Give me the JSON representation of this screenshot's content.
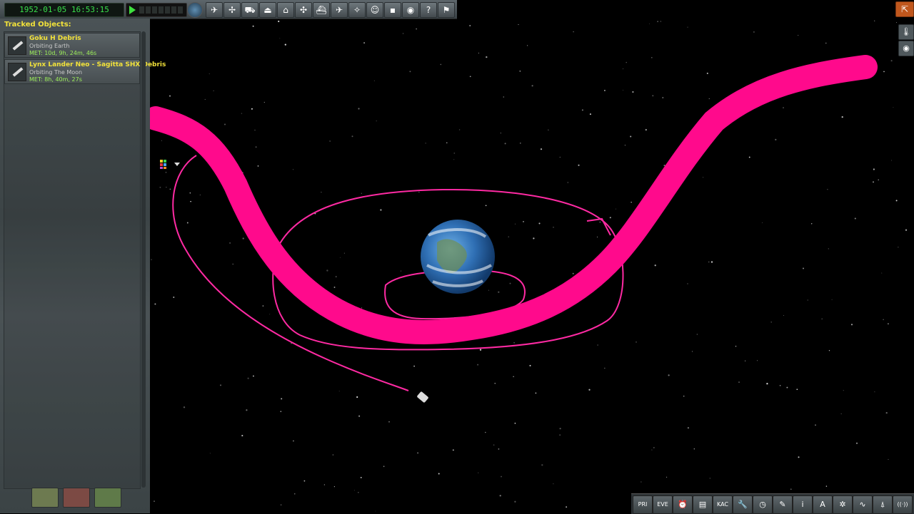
{
  "topbar": {
    "clock": "1952-01-05 16:53:15",
    "buttons": [
      {
        "name": "rocket-filter-button",
        "icon": "rocket-icon",
        "glyph": "✈"
      },
      {
        "name": "probe-filter-button",
        "icon": "probe-icon",
        "glyph": "✢"
      },
      {
        "name": "rover-filter-button",
        "icon": "rover-icon",
        "glyph": "⛟"
      },
      {
        "name": "lander-filter-button",
        "icon": "lander-icon",
        "glyph": "⏏"
      },
      {
        "name": "base-filter-button",
        "icon": "base-icon",
        "glyph": "⌂"
      },
      {
        "name": "station-filter-button",
        "icon": "station-icon",
        "glyph": "✣"
      },
      {
        "name": "ship-filter-button",
        "icon": "ship-icon",
        "glyph": "⛴"
      },
      {
        "name": "plane-filter-button",
        "icon": "plane-icon",
        "glyph": "✈"
      },
      {
        "name": "relay-filter-button",
        "icon": "relay-icon",
        "glyph": "✧"
      },
      {
        "name": "kerbal-filter-button",
        "icon": "kerbal-icon",
        "glyph": "☺"
      },
      {
        "name": "debris-filter-button",
        "icon": "debris-icon",
        "glyph": "▪"
      },
      {
        "name": "body-filter-button",
        "icon": "planet-icon",
        "glyph": "◉"
      },
      {
        "name": "help-button",
        "icon": "help-icon",
        "glyph": "?"
      },
      {
        "name": "launchpad-button",
        "icon": "launchpad-icon",
        "glyph": "⚑"
      }
    ]
  },
  "tracking": {
    "title": "Tracked Objects:",
    "items": [
      {
        "name": "Goku H Debris",
        "status": "Orbiting Earth",
        "met": "MET: 10d, 9h, 24m, 46s"
      },
      {
        "name": "Lynx Lander Neo - Sagitta SHX Debris",
        "status": "Orbiting The Moon",
        "met": "MET: 8h, 40m, 27s"
      }
    ],
    "bottom_buttons": [
      "fly-button",
      "delete-button",
      "recover-button"
    ]
  },
  "colors": {
    "orbit_line": "#ff2aa3",
    "annotation_stroke": "#ff0a8c",
    "clock_text": "#39e04b",
    "tracked_name": "#f2e23a",
    "met_text": "#9ef15a",
    "exit_button": "#c0571d"
  },
  "bottom_right": {
    "buttons": [
      {
        "name": "principia-button",
        "icon": "principia-icon",
        "glyph": "PRI"
      },
      {
        "name": "eve-button",
        "icon": "eve-icon",
        "glyph": "EVE"
      },
      {
        "name": "alarm-clock-button",
        "icon": "alarm-clock-icon",
        "glyph": "⏰"
      },
      {
        "name": "chart-button",
        "icon": "chart-icon",
        "glyph": "▤"
      },
      {
        "name": "kerbal-alarm-button",
        "icon": "kac-icon",
        "glyph": "KAC"
      },
      {
        "name": "wrench-button",
        "icon": "wrench-icon",
        "glyph": "🔧"
      },
      {
        "name": "clock-button",
        "icon": "clock-icon",
        "glyph": "◷"
      },
      {
        "name": "pencil-button",
        "icon": "pencil-icon",
        "glyph": "✎"
      },
      {
        "name": "info-button",
        "icon": "info-icon",
        "glyph": "i"
      },
      {
        "name": "autopilot-button",
        "icon": "autopilot-icon",
        "glyph": "A"
      },
      {
        "name": "settings-button",
        "icon": "settings-icon",
        "glyph": "✲"
      },
      {
        "name": "signal-button",
        "icon": "signal-icon",
        "glyph": "∿"
      },
      {
        "name": "antenna-button",
        "icon": "antenna-icon",
        "glyph": "⍋"
      },
      {
        "name": "comms-button",
        "icon": "comms-icon",
        "glyph": "((·))"
      }
    ]
  }
}
